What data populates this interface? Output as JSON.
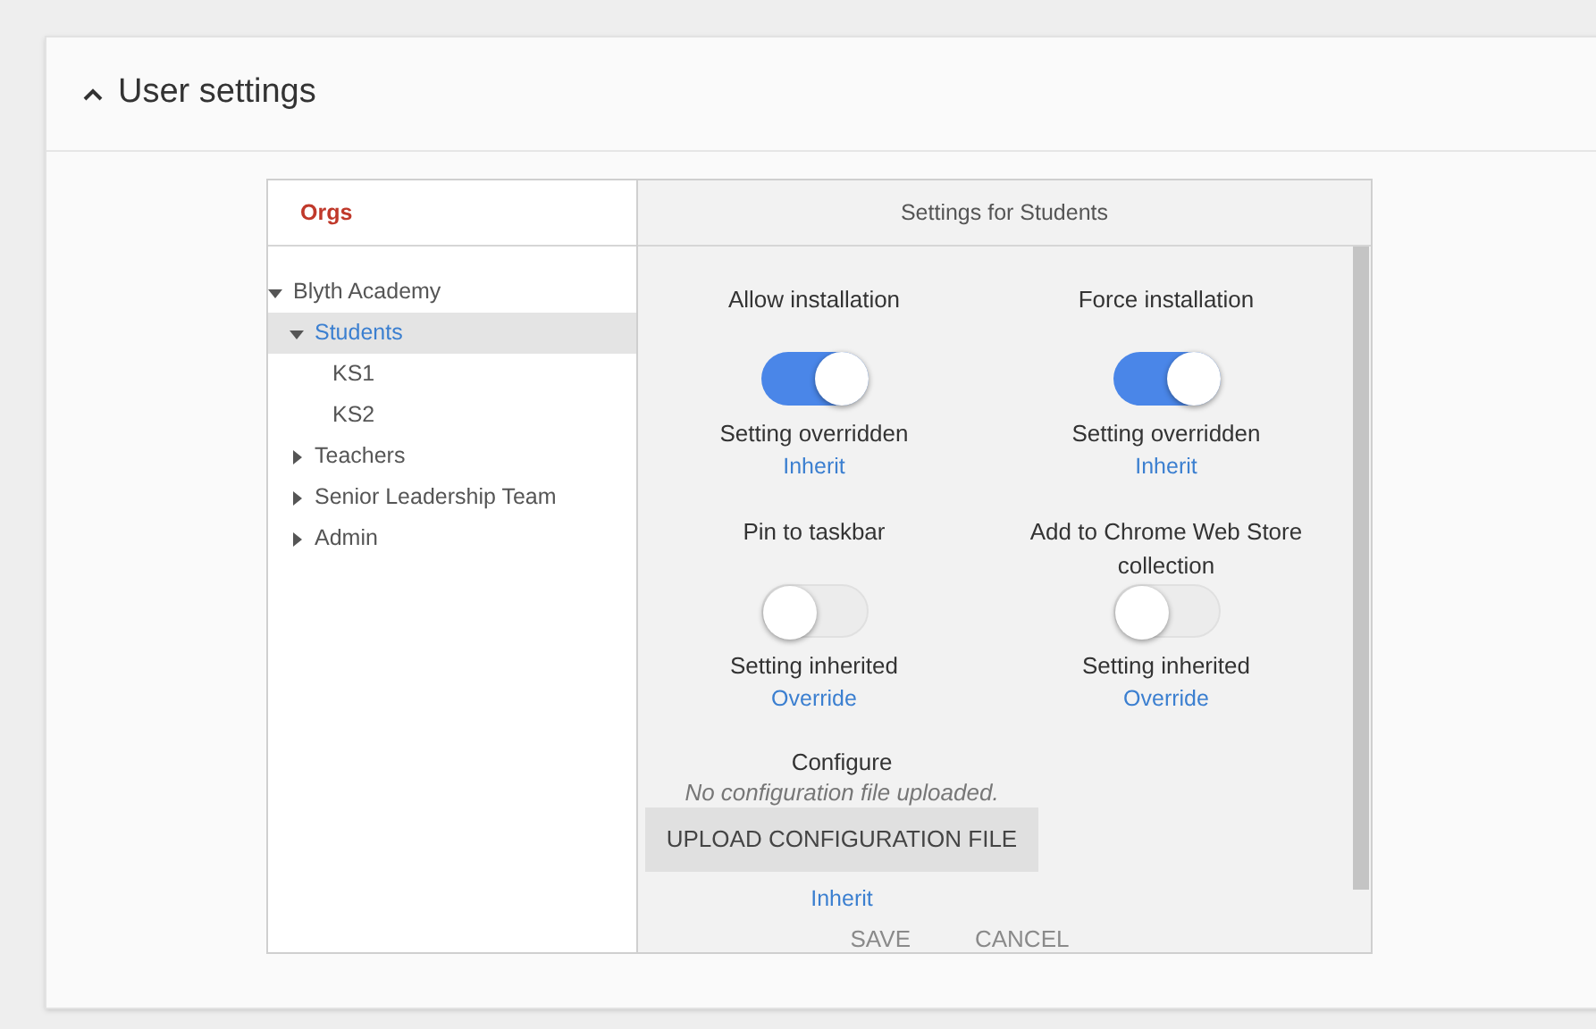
{
  "section": {
    "title": "User settings",
    "expanded": true
  },
  "orgs": {
    "title": "Orgs",
    "tree": [
      {
        "label": "Blyth Academy",
        "expanded": true,
        "selected": false,
        "children": [
          {
            "label": "Students",
            "expanded": true,
            "selected": true,
            "children": [
              {
                "label": "KS1",
                "selected": false
              },
              {
                "label": "KS2",
                "selected": false
              }
            ]
          },
          {
            "label": "Teachers",
            "expanded": false,
            "selected": false
          },
          {
            "label": "Senior Leadership Team",
            "expanded": false,
            "selected": false
          },
          {
            "label": "Admin",
            "expanded": false,
            "selected": false
          }
        ]
      }
    ]
  },
  "settings": {
    "title": "Settings for Students",
    "items": [
      {
        "kind": "toggle",
        "label": "Allow installation",
        "on": true,
        "status": "Setting overridden",
        "link": "Inherit"
      },
      {
        "kind": "toggle",
        "label": "Force installation",
        "on": true,
        "status": "Setting overridden",
        "link": "Inherit"
      },
      {
        "kind": "toggle",
        "label": "Pin to taskbar",
        "on": false,
        "status": "Setting inherited",
        "link": "Override"
      },
      {
        "kind": "toggle",
        "label": "Add to Chrome Web Store collection",
        "on": false,
        "status": "Setting inherited",
        "link": "Override"
      },
      {
        "kind": "upload",
        "label": "Configure",
        "note": "No configuration file uploaded.",
        "button": "UPLOAD CONFIGURATION FILE",
        "link": "Inherit"
      }
    ],
    "actions": [
      "SAVE",
      "CANCEL"
    ]
  }
}
